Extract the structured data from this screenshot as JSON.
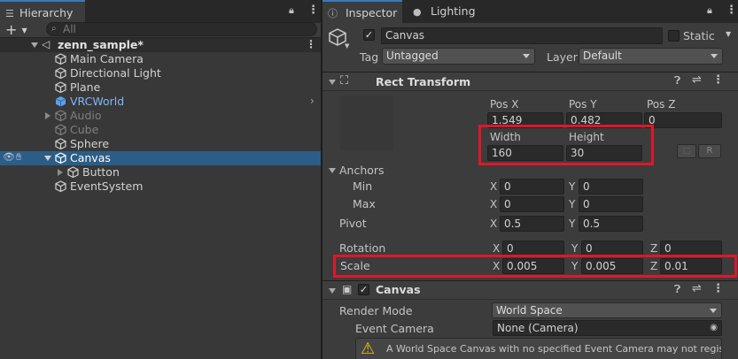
{
  "hierarchy": {
    "tab_label": "Hierarchy",
    "search_placeholder": "All",
    "add_button": "+",
    "scene_name": "zenn_sample*",
    "items": [
      {
        "label": "Main Camera"
      },
      {
        "label": "Directional Light"
      },
      {
        "label": "Plane"
      },
      {
        "label": "VRCWorld"
      },
      {
        "label": "Audio"
      },
      {
        "label": "Cube"
      },
      {
        "label": "Sphere"
      },
      {
        "label": "Canvas"
      },
      {
        "label": "Button"
      },
      {
        "label": "EventSystem"
      }
    ]
  },
  "inspector": {
    "tab_label": "Inspector",
    "lighting_tab_label": "Lighting",
    "object_name": "Canvas",
    "static_label": "Static",
    "tag_label": "Tag",
    "tag_value": "Untagged",
    "layer_label": "Layer",
    "layer_value": "Default",
    "rect_transform": {
      "title": "Rect Transform",
      "pos_x_label": "Pos X",
      "pos_y_label": "Pos Y",
      "pos_z_label": "Pos Z",
      "pos_x": "1.549",
      "pos_y": "0.482",
      "pos_z": "0",
      "width_label": "Width",
      "height_label": "Height",
      "width": "160",
      "height": "30",
      "r_button": "R",
      "anchors_label": "Anchors",
      "min_label": "Min",
      "max_label": "Max",
      "min_x": "0",
      "min_y": "0",
      "max_x": "0",
      "max_y": "0",
      "pivot_label": "Pivot",
      "pivot_x": "0.5",
      "pivot_y": "0.5",
      "rotation_label": "Rotation",
      "rot_x": "0",
      "rot_y": "0",
      "rot_z": "0",
      "scale_label": "Scale",
      "scale_x": "0.005",
      "scale_y": "0.005",
      "scale_z": "0.01",
      "axis_x": "X",
      "axis_y": "Y",
      "axis_z": "Z"
    },
    "canvas_component": {
      "title": "Canvas",
      "render_mode_label": "Render Mode",
      "render_mode_value": "World Space",
      "event_camera_label": "Event Camera",
      "event_camera_value": "None (Camera)",
      "warning_text": "A World Space Canvas with no specified Event Camera may not register UI"
    }
  },
  "colors": {
    "selection": "#2c5d87",
    "red_highlight": "#e0162b",
    "prefab_blue": "#7eb6f5",
    "accent_tab": "#3a79bb"
  }
}
